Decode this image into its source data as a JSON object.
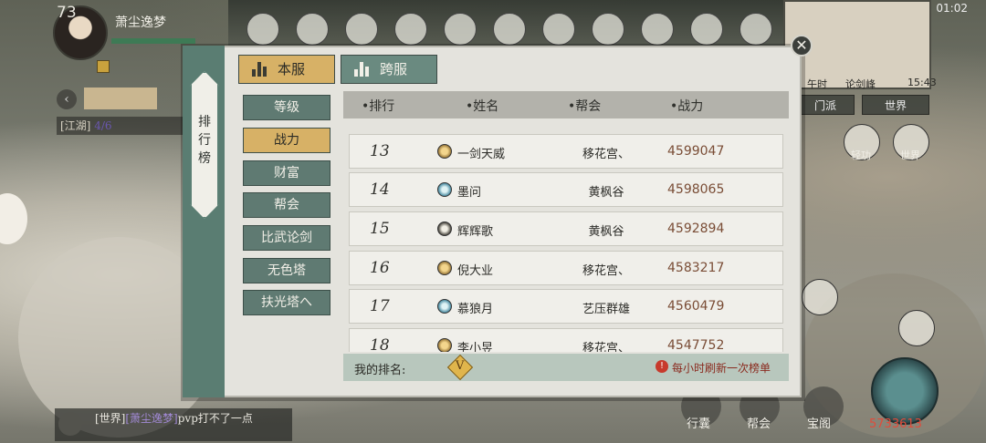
{
  "hud": {
    "level": "73",
    "player_name": "萧尘逸梦",
    "quest_text": "[江湖]",
    "quest_progress": "4/6",
    "status_time": "01:02",
    "map_time_label": "午时",
    "map_location": "论剑峰",
    "map_clock": "15:43",
    "chat_tab_sect": "门派",
    "chat_tab_world": "世界",
    "skill_label_1": "轻功",
    "skill_label_2": "世界",
    "bottom_label_1": "行囊",
    "bottom_label_2": "帮会",
    "bottom_label_3": "宝阁",
    "currency": "5733613"
  },
  "chat": {
    "channel": "[世界]",
    "sender": "[萧尘逸梦]",
    "message": "pvp打不了一点"
  },
  "leaderboard": {
    "side_title": "排行榜",
    "tabs": [
      {
        "label": "本服",
        "active": true
      },
      {
        "label": "跨服",
        "active": false
      }
    ],
    "categories": [
      {
        "label": "等级",
        "active": false
      },
      {
        "label": "战力",
        "active": true
      },
      {
        "label": "财富",
        "active": false
      },
      {
        "label": "帮会",
        "active": false
      },
      {
        "label": "比武论剑",
        "active": false
      },
      {
        "label": "无色塔",
        "active": false
      },
      {
        "label": "扶光塔へ",
        "active": false
      }
    ],
    "columns": {
      "rank": "•排行",
      "name": "•姓名",
      "guild": "•帮会",
      "power": "•战力"
    },
    "rows": [
      {
        "rank": "13",
        "gem": "gold",
        "name": "一剑天威",
        "guild": "移花宫、",
        "power": "4599047"
      },
      {
        "rank": "14",
        "gem": "blue",
        "name": "墨问",
        "guild": "黄枫谷",
        "power": "4598065"
      },
      {
        "rank": "15",
        "gem": "dark",
        "name": "辉辉歌",
        "guild": "黄枫谷",
        "power": "4592894"
      },
      {
        "rank": "16",
        "gem": "gold",
        "name": "倪大业",
        "guild": "移花宫、",
        "power": "4583217"
      },
      {
        "rank": "17",
        "gem": "blue",
        "name": "慕狼月",
        "guild": "艺压群雄",
        "power": "4560479"
      },
      {
        "rank": "18",
        "gem": "gold",
        "name": "李小昱",
        "guild": "移花宫、",
        "power": "4547752"
      }
    ],
    "my_rank_label": "我的排名:",
    "my_rank_value": "V",
    "refresh_note": "每小时刷新一次榜单"
  },
  "colors": {
    "accent_gold": "#d7b166",
    "teal": "#5f7a72",
    "power_text": "#7a4d36",
    "warning": "#c73a2c"
  }
}
